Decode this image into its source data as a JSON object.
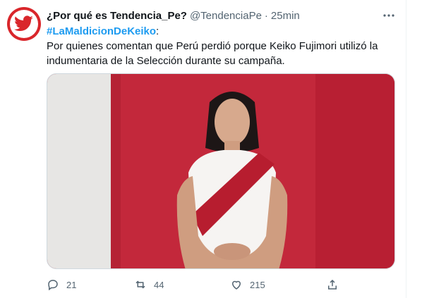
{
  "tweet": {
    "author_name": "¿Por qué es Tendencia_Pe?",
    "handle": "@TendenciaPe",
    "separator": "·",
    "time": "25min",
    "more_icon": "more-horizontal-icon",
    "hashtag": "#LaMaldicionDeKeiko",
    "hashtag_suffix": ":",
    "body": "Por quienes comentan que Perú perdió porque Keiko Fujimori utilizó la indumentaria de la Selección durante su campaña."
  },
  "avatar": {
    "icon": "bird-icon",
    "bg_color": "#d9262b"
  },
  "actions": {
    "reply_count": "21",
    "retweet_count": "44",
    "like_count": "215"
  },
  "colors": {
    "accent": "#1d9bf0",
    "muted": "#536471",
    "text": "#0f1419"
  }
}
